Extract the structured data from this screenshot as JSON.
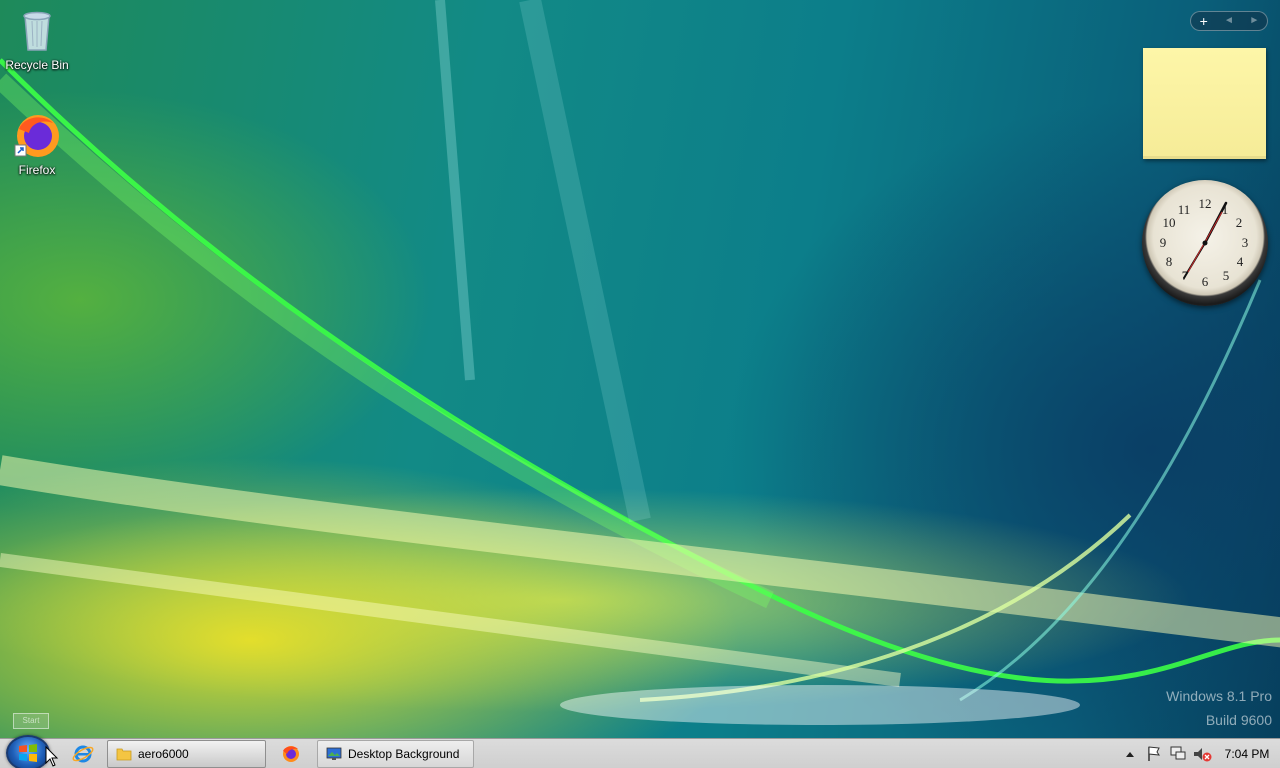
{
  "desktop": {
    "icons": [
      {
        "label": "Recycle Bin",
        "icon": "recycle-bin-icon"
      },
      {
        "label": "Firefox",
        "icon": "firefox-icon"
      }
    ],
    "watermark": {
      "line1": "Windows 8.1 Pro",
      "line2": "Build 9600"
    },
    "show_desktop_hint": "Start"
  },
  "gadgets": {
    "add_label": "+",
    "prev_label": "◄",
    "next_label": "►",
    "clock_numbers": [
      "12",
      "1",
      "2",
      "3",
      "4",
      "5",
      "6",
      "7",
      "8",
      "9",
      "10",
      "11"
    ]
  },
  "taskbar": {
    "tasks": [
      {
        "label": "aero6000",
        "icon": "folder-icon",
        "active": true
      },
      {
        "label": "Desktop Background",
        "icon": "desktop-background-icon",
        "active": false
      }
    ],
    "pinned": [
      {
        "name": "internet-explorer-icon"
      },
      {
        "name": "firefox-icon"
      }
    ],
    "tray": {
      "time": "7:04 PM",
      "icons": [
        "show-hidden-icons-icon",
        "action-center-flag-icon",
        "network-icon",
        "volume-muted-icon"
      ]
    }
  },
  "colors": {
    "taskbar": "#d4d4d4",
    "sticky_note": "#fdf6a8",
    "start_orb": "#1f5fb8"
  }
}
